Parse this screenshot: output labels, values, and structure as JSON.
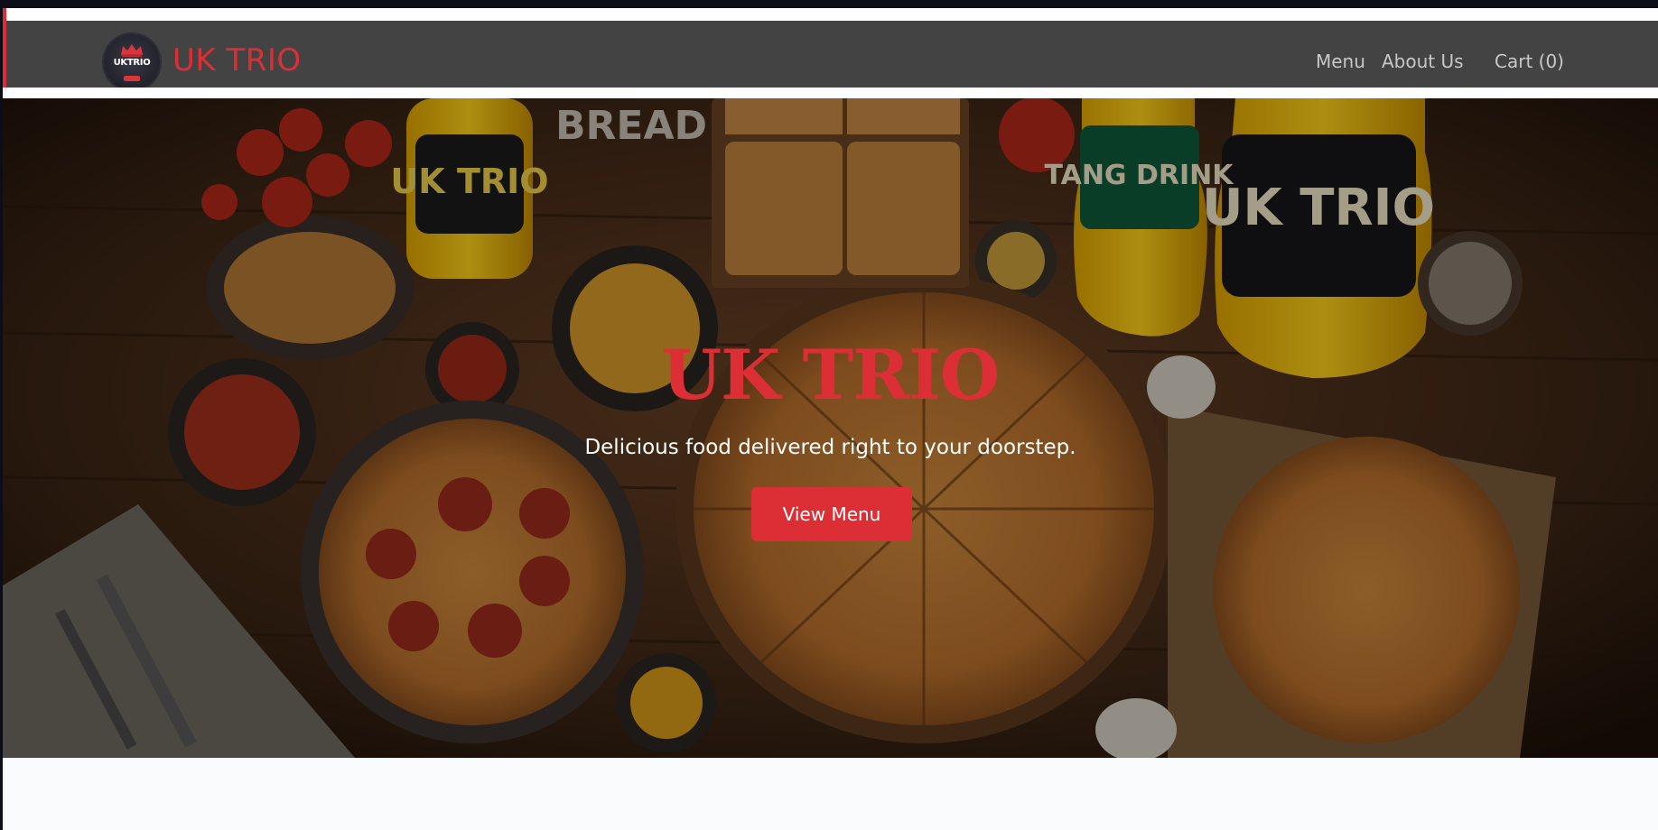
{
  "brand": {
    "logo_text": "UKTRIO",
    "name": "UK TRIO"
  },
  "nav": {
    "items": [
      {
        "label": "Menu"
      },
      {
        "label": "About Us"
      },
      {
        "label": "Cart (0)"
      }
    ]
  },
  "hero": {
    "title": "UK TRIO",
    "subtitle": "Delicious food delivered right to your doorstep.",
    "button_label": "View Menu",
    "image_labels": [
      "BREAD",
      "UK TRIO",
      "TANG DRINK",
      "UK TRIO"
    ]
  },
  "colors": {
    "accent": "#dc2f35",
    "navbar": "#434343",
    "nav_text": "#c8c8c8"
  },
  "icons": {
    "logo": "uk-trio-logo-icon"
  }
}
